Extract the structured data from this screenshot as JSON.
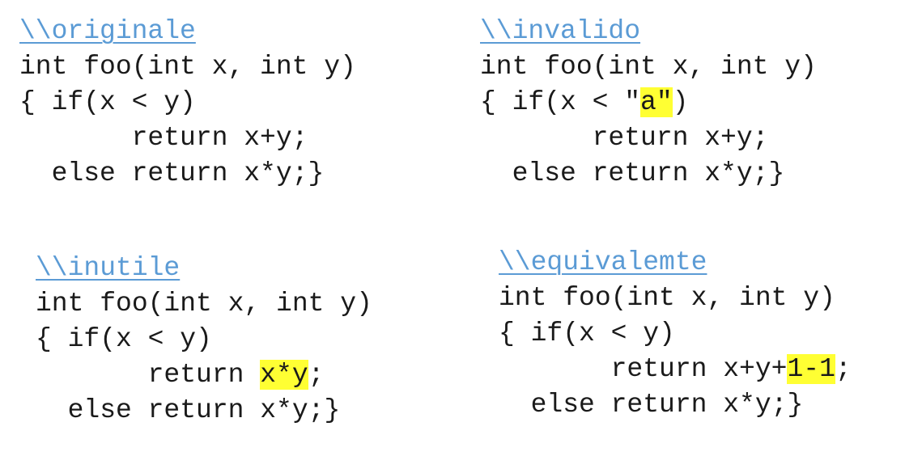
{
  "blocks": {
    "original": {
      "title": "\\\\originale",
      "line1": "int foo(int x, int y)",
      "line2": "{ if(x < y)",
      "line3_prefix": "       return ",
      "line3_expr": "x+y;",
      "line4": "  else return x*y;}"
    },
    "invalid": {
      "title": "\\\\invalido",
      "line1": "int foo(int x, int y)",
      "line2_prefix": "{ if(x < \"",
      "line2_highlight": "a\"",
      "line2_suffix": ")",
      "line3": "       return x+y;",
      "line4": "  else return x*y;}"
    },
    "useless": {
      "title": "\\\\inutile",
      "line1": "int foo(int x, int y)",
      "line2": "{ if(x < y)",
      "line3_prefix": "       return ",
      "line3_highlight": "x*y",
      "line3_suffix": ";",
      "line4": "  else return x*y;}"
    },
    "equivalent": {
      "title": "\\\\equivalemte",
      "line1": "int foo(int x, int y)",
      "line2": "{ if(x < y)",
      "line3_prefix": "       return x+y+",
      "line3_highlight": "1-1",
      "line3_suffix": ";",
      "line4": "  else return x*y;}"
    }
  },
  "colors": {
    "title": "#5b9bd5",
    "highlight": "#ffff33",
    "text": "#1a1a1a"
  }
}
